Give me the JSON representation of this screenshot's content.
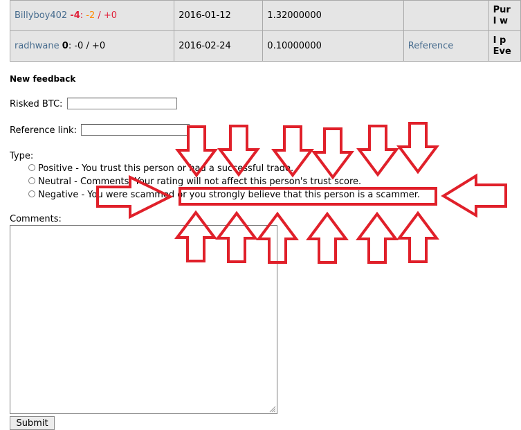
{
  "feedback_rows": [
    {
      "user": "Billyboy402",
      "score_risked": "-4",
      "score_sep": ": ",
      "score_neg": "-2",
      "score_slash": " / ",
      "score_pos": "+0",
      "date": "2016-01-12",
      "amount": "1.32000000",
      "reference": "",
      "comment_line1": "Pur",
      "comment_line2": "I w"
    },
    {
      "user": "radhwane",
      "score_risked": "0",
      "score_sep": ": ",
      "score_neg": "-0",
      "score_slash": " / ",
      "score_pos": "+0",
      "date": "2016-02-24",
      "amount": "0.10000000",
      "reference": "Reference",
      "comment_line1": "I p",
      "comment_line2": "Eve"
    }
  ],
  "form": {
    "title": "New feedback",
    "risked_label": "Risked BTC:",
    "risked_value": "",
    "reference_label": "Reference link:",
    "reference_value": "",
    "type_label": "Type:",
    "options": [
      {
        "value": "Positive",
        "desc": " - You trust this person or had a successful trade."
      },
      {
        "value": "Neutral",
        "desc": " - Comments. Your rating will not affect this person's trust score."
      },
      {
        "value": "Negative",
        "desc": " - You were scammed or you strongly believe that this person is a scammer."
      }
    ],
    "comments_label": "Comments:",
    "comments_value": "",
    "submit_label": "Submit"
  },
  "annotation": {
    "color": "#e0202a",
    "down_arrow_count": 6,
    "up_arrow_count": 6,
    "side_arrow_count": 2,
    "highlight_box": true
  }
}
